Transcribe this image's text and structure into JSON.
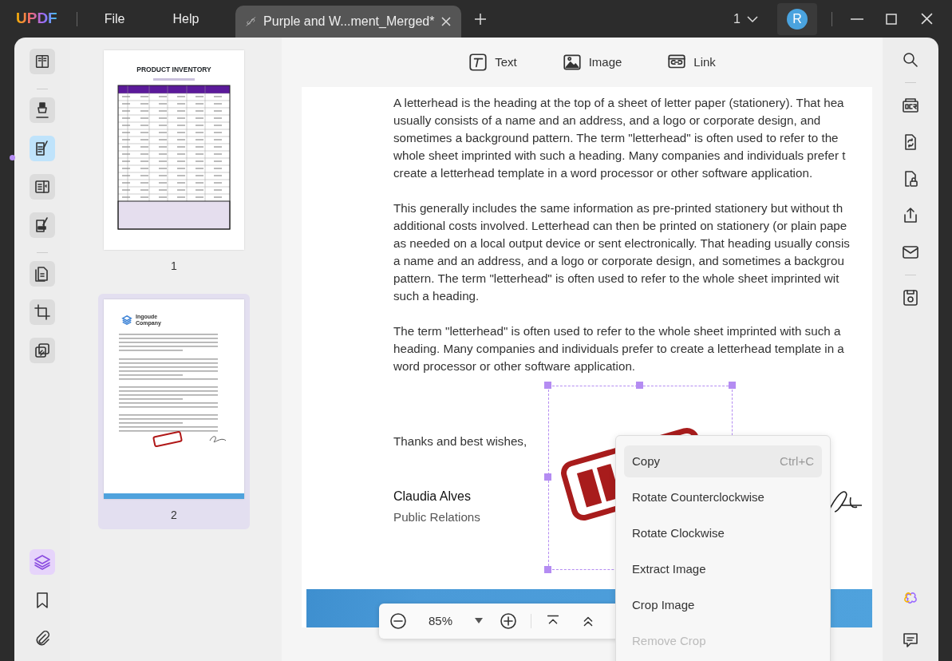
{
  "app": {
    "logo": "UPDF",
    "menu": [
      "File",
      "Help"
    ]
  },
  "tab": {
    "title": "Purple and W...ment_Merged*"
  },
  "page_selector": "1",
  "avatar": "R",
  "left_tool_groups": [
    [
      {
        "kind": "comment",
        "selected": false
      },
      {
        "kind": "edit",
        "selected": true
      },
      {
        "kind": "form",
        "selected": false
      },
      {
        "kind": "sign",
        "selected": false
      }
    ],
    [
      {
        "kind": "organize",
        "selected": false
      },
      {
        "kind": "crop",
        "selected": false
      },
      {
        "kind": "combine",
        "selected": false
      }
    ]
  ],
  "bottom_tools": [
    {
      "kind": "layers",
      "selected": true
    },
    {
      "kind": "bookmark",
      "selected": false
    },
    {
      "kind": "attachment",
      "selected": false
    }
  ],
  "toolbar": [
    {
      "kind": "text",
      "label": "Text"
    },
    {
      "kind": "image",
      "label": "Image"
    },
    {
      "kind": "link",
      "label": "Link"
    }
  ],
  "thumbnails": [
    {
      "kind": "inventory",
      "title": "PRODUCT INVENTORY",
      "number": "1",
      "selected": false
    },
    {
      "kind": "letter",
      "title": "Ingoude Company",
      "number": "2",
      "selected": true
    }
  ],
  "document": {
    "paragraphs": [
      [
        "A letterhead is the heading at the top of a sheet of letter paper (stationery). That hea",
        "usually consists of a name and an address, and a logo or corporate design, and",
        "sometimes a background pattern. The term \"letterhead\" is often used to refer to the",
        "whole sheet imprinted with such a heading. Many companies and individuals prefer t",
        "create a letterhead template in a word processor or other software application."
      ],
      [
        "This generally includes the same information as pre-printed stationery but without th",
        "additional costs involved. Letterhead can then be printed on stationery (or plain pape",
        "as needed on a local output device or sent electronically. That heading usually consis",
        "a name and an address, and a logo or corporate design, and sometimes a backgrou",
        "pattern. The term \"letterhead\" is often used to refer to the whole sheet imprinted wit",
        "such a heading."
      ],
      [
        "The term \"letterhead\" is often used to refer to the whole sheet imprinted with such a",
        "heading. Many companies and individuals prefer to create a letterhead template in a",
        "word processor or other software application."
      ]
    ],
    "closing": "Thanks and best wishes,",
    "signer_name": "Claudia Alves",
    "signer_role": "Public Relations"
  },
  "zoom": {
    "value": "85%"
  },
  "context_menu": [
    {
      "label": "Copy",
      "shortcut": "Ctrl+C",
      "selected": true,
      "disabled": false
    },
    {
      "label": "Rotate Counterclockwise",
      "selected": false,
      "disabled": false
    },
    {
      "label": "Rotate Clockwise",
      "selected": false,
      "disabled": false
    },
    {
      "label": "Extract Image",
      "selected": false,
      "disabled": false
    },
    {
      "label": "Crop Image",
      "selected": false,
      "disabled": false
    },
    {
      "label": "Remove Crop",
      "selected": false,
      "disabled": true
    }
  ],
  "right_tool_groups": [
    [
      {
        "kind": "search"
      }
    ],
    [
      {
        "kind": "ocr"
      },
      {
        "kind": "convert"
      },
      {
        "kind": "protect"
      },
      {
        "kind": "share"
      },
      {
        "kind": "email"
      }
    ],
    [
      {
        "kind": "save"
      }
    ]
  ],
  "right_bottom_tools": [
    {
      "kind": "ai"
    },
    {
      "kind": "comment"
    }
  ]
}
